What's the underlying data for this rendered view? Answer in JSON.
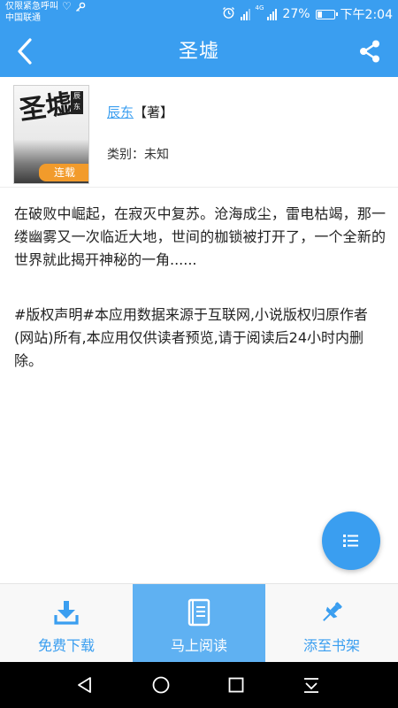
{
  "status_bar": {
    "emergency_text": "仅限紧急呼叫",
    "carrier": "中国联通",
    "network_type": "4G",
    "battery": "27%",
    "battery_level": 0.27,
    "time": "下午2:04"
  },
  "header": {
    "title": "圣墟",
    "back_icon": "chevron-left-icon",
    "share_icon": "share-icon"
  },
  "book": {
    "cover_title": "圣墟",
    "cover_seal": "辰东",
    "status_badge": "连载",
    "author": "辰东",
    "author_role": "【著】",
    "category": "类别：未知"
  },
  "description": "在破败中崛起，在寂灭中复苏。沧海成尘，雷电枯竭，那一缕幽雾又一次临近大地，世间的枷锁被打开了，一个全新的世界就此揭开神秘的一角......",
  "copyright_notice": "#版权声明#本应用数据来源于互联网,小说版权归原作者(网站)所有,本应用仅供读者预览,请于阅读后24小时内删除。",
  "actions": [
    {
      "label": "免费下载",
      "icon": "download-icon"
    },
    {
      "label": "马上阅读",
      "icon": "book-icon"
    },
    {
      "label": "添至书架",
      "icon": "pin-icon"
    }
  ],
  "fab_icon": "list-icon",
  "colors": {
    "brand": "#3a9ef0",
    "primary_action": "#5fb1f2",
    "badge": "#f29b2b"
  }
}
